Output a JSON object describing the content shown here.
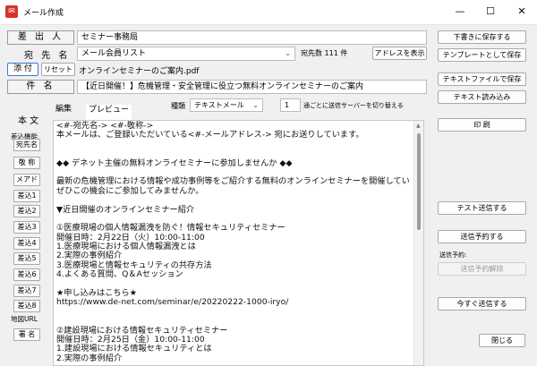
{
  "window": {
    "title": "メール作成",
    "min_icon": "—",
    "max_icon": "☐",
    "close_icon": "✕"
  },
  "header": {
    "sender_label": "差 出 人",
    "sender_value": "セミナー事務局",
    "to_label": "宛 先 名",
    "to_value": "メール会員リスト",
    "recipient_count": "宛先数 111 件",
    "show_address": "アドレスを表示",
    "attach_button": "添 付",
    "reset_button": "リセット",
    "attachment_file": "オンラインセミナーのご案内.pdf",
    "subject_label": "件 名",
    "subject_value": "【近日開催！】危機管理・安全管理に役立つ無料オンラインセミナーのご案内"
  },
  "body_section": {
    "body_label": "本 文",
    "insert_func_label": "差込機能",
    "tab_edit": "編集",
    "tab_preview": "プレビュー",
    "type_label": "種類",
    "type_value": "テキストメール",
    "spin_value": "1",
    "switch_note": "通ごとに送信サーバーを切り替える"
  },
  "side_buttons": [
    "宛先名",
    "敬 称",
    "メアド",
    "差込1",
    "差込2",
    "差込3",
    "差込4",
    "差込5",
    "差込6",
    "差込7",
    "差込8"
  ],
  "map_url_label": "地図URL",
  "signature_button": "署 名",
  "right_buttons": {
    "save_draft": "下書きに保存する",
    "save_template": "テンプレートとして保存",
    "save_text_file": "テキストファイルで保存",
    "load_text": "テキスト読み込み",
    "print": "印 刷",
    "test_send": "テスト送信する",
    "schedule_send": "送信予約する",
    "schedule_label": "送信予約:",
    "cancel_schedule": "送信予約解除",
    "send_now": "今すぐ送信する",
    "close": "閉じる"
  },
  "editor_lines": [
    "<#-宛先名-> <#-敬称->",
    "本メールは、ご登録いただいている<#-メールアドレス-> 宛にお送りしています。",
    "",
    "",
    "◆◆ デネット主催の無料オンライセミナーに参加しませんか ◆◆",
    "",
    "最新の危機管理における情報や成功事例等をご紹介する無料のオンラインセミナーを開催してい",
    "ぜひこの機会にご参加してみませんか。",
    "",
    "▼近日開催のオンラインセミナー紹介",
    "",
    "①医療現場の個人情報漏洩を防ぐ！情報セキュリティセミナー",
    "開催日時：2月22日（火）10:00-11:00",
    "1.医療現場における個人情報漏洩とは",
    "2.実際の事例紹介",
    "3.医療現場と情報セキュリティの共存方法",
    "4.よくある質問、Q＆Aセッション",
    "",
    "★申し込みはこちら★",
    "https://www.de-net.com/seminar/e/20220222-1000-iryo/",
    "",
    "",
    "②建設現場における情報セキュリティセミナー",
    "開催日時：2月25日（金）10:00-11:00",
    "1.建設現場における情報セキュリティとは",
    "2.実際の事例紹介"
  ]
}
